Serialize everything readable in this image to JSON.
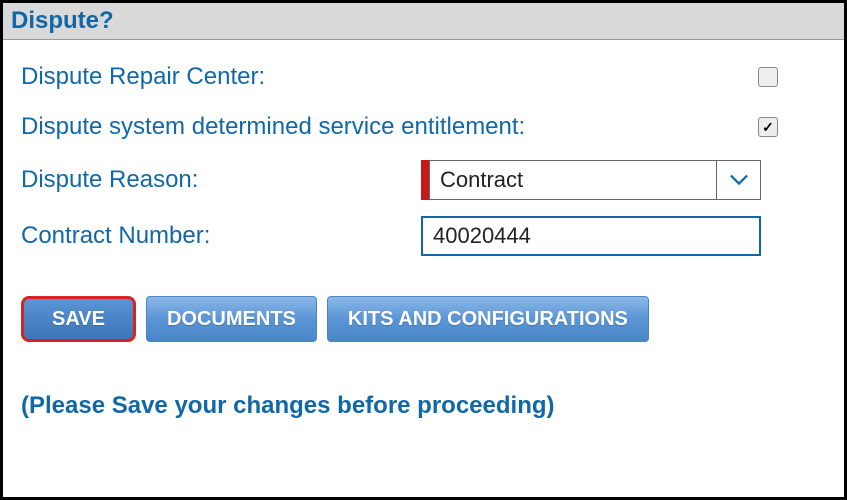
{
  "header": {
    "title": "Dispute?"
  },
  "fields": {
    "disputeRepairCenter": {
      "label": "Dispute Repair Center:",
      "checked": false
    },
    "disputeEntitlement": {
      "label": "Dispute system determined service entitlement:",
      "checked": true
    },
    "disputeReason": {
      "label": "Dispute Reason:",
      "value": "Contract"
    },
    "contractNumber": {
      "label": "Contract Number:",
      "value": "40020444"
    }
  },
  "buttons": {
    "save": "SAVE",
    "documents": "DOCUMENTS",
    "kits": "KITS AND CONFIGURATIONS"
  },
  "footer": {
    "note": "(Please Save your changes before proceeding)"
  }
}
